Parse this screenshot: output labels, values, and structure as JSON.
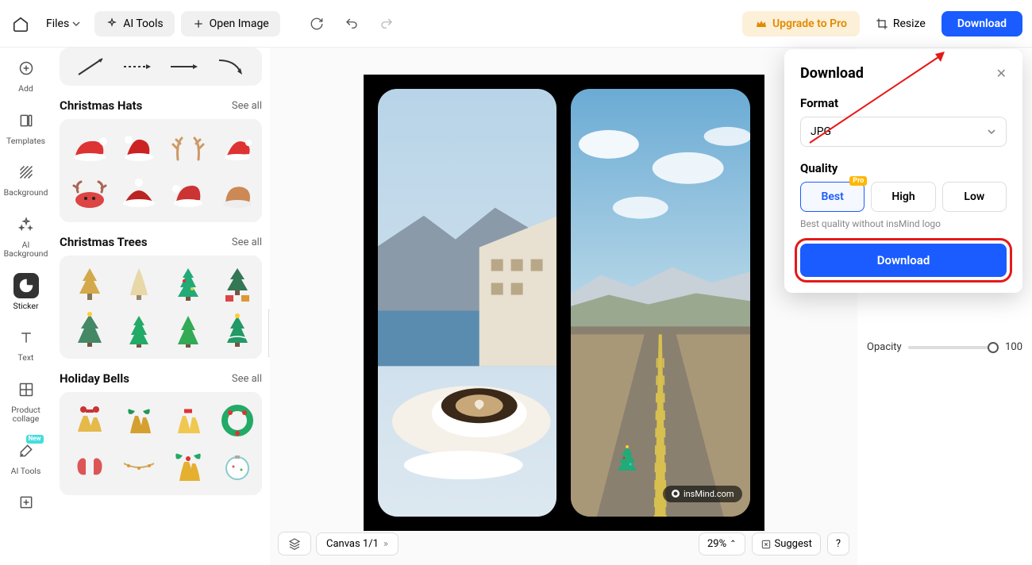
{
  "topbar": {
    "files": "Files",
    "ai_tools": "AI Tools",
    "open_image": "Open Image",
    "upgrade": "Upgrade to Pro",
    "resize": "Resize",
    "download": "Download"
  },
  "rail": {
    "add": "Add",
    "templates": "Templates",
    "background": "Background",
    "ai_background": "AI Background",
    "sticker": "Sticker",
    "text": "Text",
    "product_collage": "Product collage",
    "ai_tools": "AI Tools",
    "new_badge": "New"
  },
  "sections": {
    "hats": {
      "title": "Christmas Hats",
      "see_all": "See all"
    },
    "trees": {
      "title": "Christmas Trees",
      "see_all": "See all"
    },
    "bells": {
      "title": "Holiday Bells",
      "see_all": "See all"
    }
  },
  "canvas": {
    "label": "Canvas 1/1",
    "zoom": "29%",
    "suggest": "Suggest",
    "watermark": "insMind.com"
  },
  "right": {
    "opacity_label": "Opacity",
    "opacity_value": "100"
  },
  "download_popover": {
    "title": "Download",
    "format_label": "Format",
    "format_value": "JPG",
    "quality_label": "Quality",
    "best": "Best",
    "high": "High",
    "low": "Low",
    "pro_tag": "Pro",
    "hint": "Best quality without insMind logo",
    "button": "Download"
  }
}
